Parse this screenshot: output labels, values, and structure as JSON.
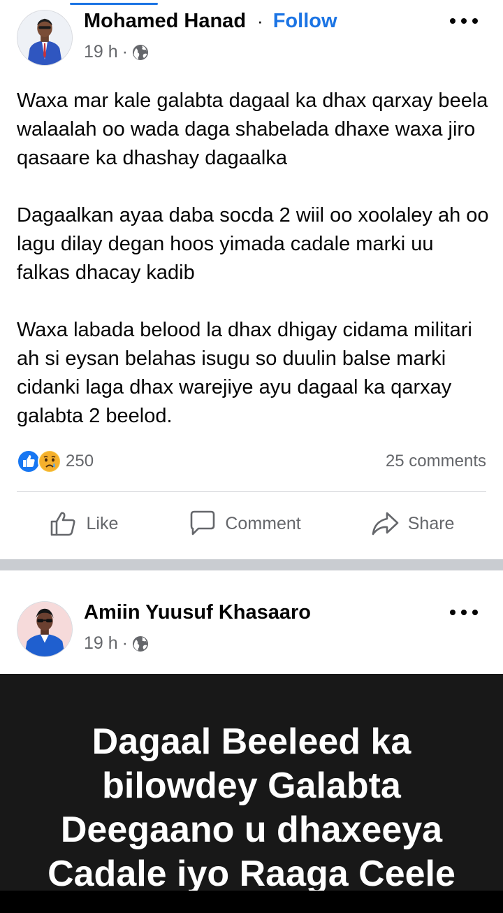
{
  "post1": {
    "author": "Mohamed Hanad",
    "separator": "·",
    "follow_label": "Follow",
    "time": "19 h",
    "meta_dot": "·",
    "paragraphs": [
      "Waxa mar kale galabta dagaal ka dhax qarxay beela walaalah oo wada daga shabelada dhaxe waxa jiro qasaare ka dhashay dagaalka",
      "Dagaalkan ayaa daba socda 2 wiil oo xoolaley ah oo lagu dilay degan hoos yimada cadale marki uu falkas dhacay kadib",
      "Waxa labada belood la dhax dhigay cidama militari ah si eysan belahas isugu so duulin balse marki cidanki laga dhax warejiye ayu dagaal ka qarxay galabta 2 beelod."
    ],
    "reaction_count": "250",
    "reactions": [
      "like-icon",
      "sad-icon"
    ],
    "comments": "25 comments",
    "actions": {
      "like": "Like",
      "comment": "Comment",
      "share": "Share"
    }
  },
  "post2": {
    "author": "Amiin Yuusuf Khasaaro",
    "time": "19 h",
    "meta_dot": "·",
    "video_title": "Dagaal Beeleed ka bilowdey Galabta Deegaano u dhaxeeya Cadale iyo Raaga Ceele"
  },
  "colors": {
    "accent": "#1b74e4",
    "text": "#050505",
    "secondary_text": "#65676b",
    "separator": "#c9ccd1",
    "video_bg": "#181818"
  }
}
